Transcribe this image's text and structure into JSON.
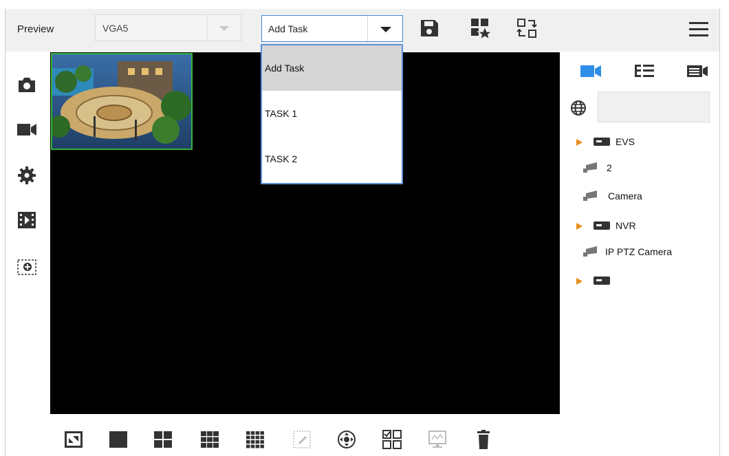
{
  "header": {
    "preview_label": "Preview",
    "view_select": {
      "value": "VGA5"
    },
    "task_select": {
      "value": "Add Task"
    }
  },
  "task_dropdown": {
    "items": [
      {
        "label": "Add Task",
        "selected": true
      },
      {
        "label": "TASK 1",
        "selected": false
      },
      {
        "label": "TASK 2",
        "selected": false
      }
    ]
  },
  "device_tree": {
    "items": [
      {
        "type": "group",
        "label": "EVS"
      },
      {
        "type": "camera",
        "label": "2"
      },
      {
        "type": "camera",
        "label": "Camera"
      },
      {
        "type": "group",
        "label": "NVR"
      },
      {
        "type": "camera",
        "label": "IP PTZ Camera"
      },
      {
        "type": "group",
        "label": ""
      }
    ]
  },
  "colors": {
    "accent": "#2e8ee8",
    "tree_caret": "#e8901e",
    "selected_pane_border": "#35b33b"
  }
}
